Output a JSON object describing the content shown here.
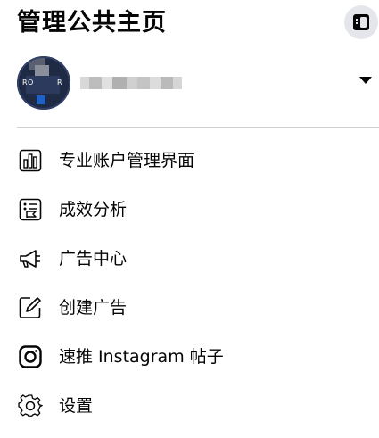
{
  "header": {
    "title": "管理公共主页",
    "collapse_icon": "sidebar-collapse-icon"
  },
  "profile": {
    "avatar_text_left": "RO",
    "avatar_text_right": "R",
    "dropdown_icon": "caret-down-icon"
  },
  "menu": {
    "items": [
      {
        "label": "专业账户管理界面",
        "icon": "bar-chart-icon"
      },
      {
        "label": "成效分析",
        "icon": "insights-flag-icon"
      },
      {
        "label": "广告中心",
        "icon": "megaphone-icon"
      },
      {
        "label": "创建广告",
        "icon": "edit-pencil-icon"
      },
      {
        "label": "速推 Instagram 帖子",
        "icon": "instagram-icon"
      },
      {
        "label": "设置",
        "icon": "gear-icon"
      }
    ]
  },
  "colors": {
    "text": "#050505",
    "button_bg": "#e4e6eb",
    "divider": "#ced0d4"
  }
}
